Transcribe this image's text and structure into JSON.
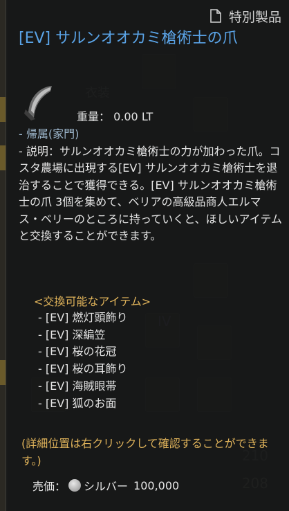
{
  "badge": {
    "icon": "document-icon",
    "label": "特別製品"
  },
  "item": {
    "name": "[EV] サルンオオカミ槍術士の爪",
    "icon": "claw-icon",
    "weight_label": "重量：",
    "weight_value": "0.00 LT"
  },
  "belong": "- 帰属(家門)",
  "description": "- 説明：サルンオオカミ槍術士の力が加わった爪。コスタ農場に出現する[EV] サルンオオカミ槍術士を退治することで獲得できる。[EV] サルンオオカミ槍術士の爪 3個を集めて、ベリアの高級品商人エルマス・ベリーのところに持っていくと、ほしいアイテムと交換することができます。",
  "exchange": {
    "title": "<交換可能なアイテム>",
    "items": [
      "- [EV] 燃灯頭飾り",
      "- [EV] 深編笠",
      "- [EV] 桜の花冠",
      "- [EV] 桜の耳飾り",
      "- [EV] 海賊眼帯",
      "- [EV] 狐のお面"
    ]
  },
  "note": "(詳細位置は右クリックして確認することができます。)",
  "price": {
    "label": "売価：",
    "currency": "シルバー",
    "value": "100,000"
  },
  "background": {
    "bg_label": "衣装",
    "num_a": "210",
    "num_b": "208",
    "roman": "IV"
  },
  "colors": {
    "title": "#5aa3e6",
    "accent": "#e0b35a"
  }
}
